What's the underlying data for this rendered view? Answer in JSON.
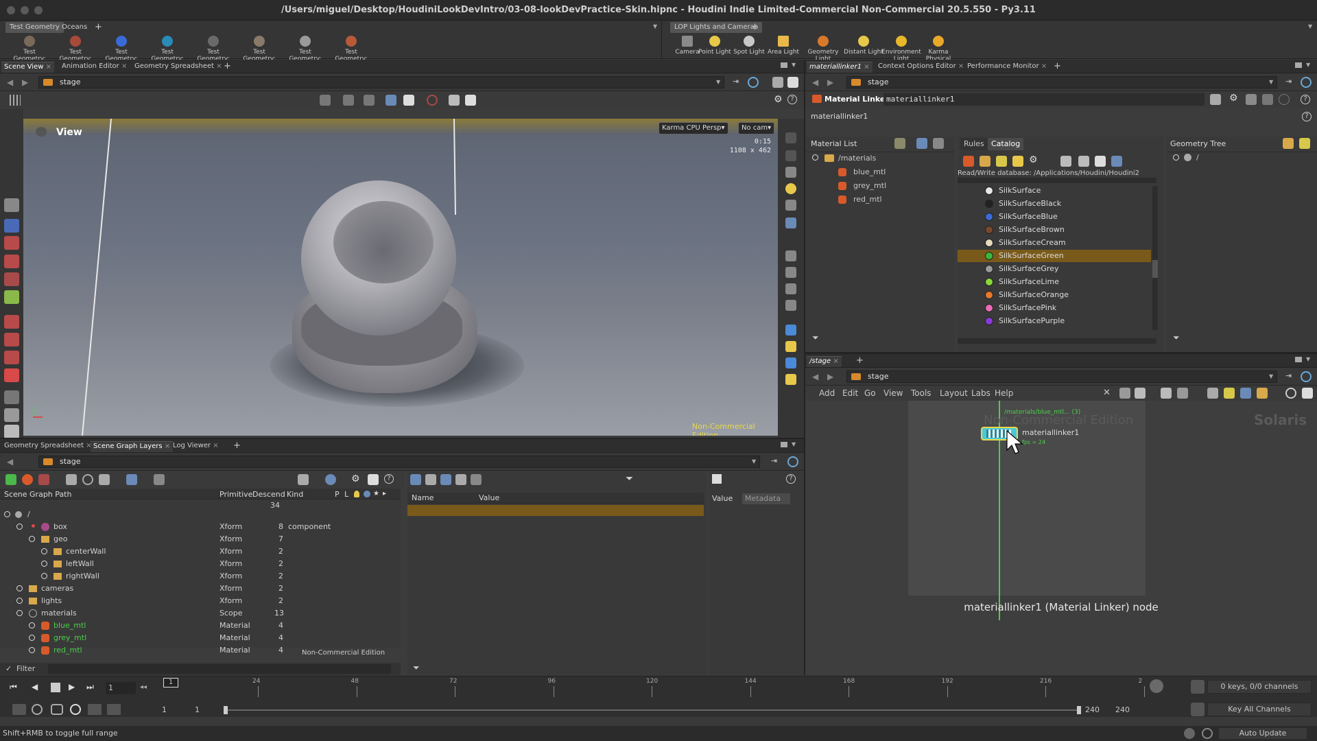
{
  "window": {
    "title": "/Users/miguel/Desktop/HoudiniLookDevIntro/03-08-lookDevPractice-Skin.hipnc - Houdini Indie Limited-Commercial Non-Commercial 20.5.550 - Py3.11"
  },
  "shelf_left": {
    "tabs": [
      "Test Geometry",
      "Oceans"
    ],
    "tools": [
      "Test Geometry: C...",
      "Test Geometry: P...",
      "Test Geometry: R...",
      "Test Geometry: S...",
      "Test Geometry: S...",
      "Test Geometry: T...",
      "Test Geometry: T...",
      "Test Geometry: T..."
    ]
  },
  "shelf_right": {
    "tabs": [
      "LOP Lights and Cameras"
    ],
    "tools": [
      "Camera",
      "Point Light",
      "Spot Light",
      "Area Light",
      "Geometry Light",
      "Distant Light",
      "Environment Light",
      "Karma Physical Sky..."
    ]
  },
  "viewport_panel": {
    "tabs": [
      "Scene View",
      "Animation Editor",
      "Geometry Spreadsheet"
    ],
    "path": "stage",
    "view_label": "View",
    "renderer": "Karma CPU",
    "persp": "Persp",
    "camera": "No cam",
    "time_readout": "0:15",
    "resolution_readout": "1108 x 462",
    "watermark": "Non-Commercial Edition"
  },
  "scene_graph_panel": {
    "tabs": [
      "Geometry Spreadsheet",
      "Scene Graph Layers",
      "Log Viewer"
    ],
    "path": "stage",
    "columns": [
      "Scene Graph Path",
      "Primitive",
      "Descend",
      "Kind",
      "P",
      "L"
    ],
    "root_count": "34",
    "rows": [
      {
        "name": "/",
        "prim": "",
        "desc": "34",
        "kind": ""
      },
      {
        "name": "box",
        "prim": "Xform",
        "desc": "8",
        "kind": "component"
      },
      {
        "name": "geo",
        "prim": "Xform",
        "desc": "7",
        "kind": ""
      },
      {
        "name": "centerWall",
        "prim": "Xform",
        "desc": "2",
        "kind": ""
      },
      {
        "name": "leftWall",
        "prim": "Xform",
        "desc": "2",
        "kind": ""
      },
      {
        "name": "rightWall",
        "prim": "Xform",
        "desc": "2",
        "kind": ""
      },
      {
        "name": "cameras",
        "prim": "Xform",
        "desc": "2",
        "kind": ""
      },
      {
        "name": "lights",
        "prim": "Xform",
        "desc": "2",
        "kind": ""
      },
      {
        "name": "materials",
        "prim": "Scope",
        "desc": "13",
        "kind": ""
      },
      {
        "name": "blue_mtl",
        "prim": "Material",
        "desc": "4",
        "kind": ""
      },
      {
        "name": "grey_mtl",
        "prim": "Material",
        "desc": "4",
        "kind": ""
      },
      {
        "name": "red_mtl",
        "prim": "Material",
        "desc": "4",
        "kind": ""
      }
    ],
    "filter_label": "Filter",
    "watermark": "Non-Commercial Edition",
    "details_columns": [
      "Name",
      "Value"
    ],
    "value_tabs": [
      "Value",
      "Metadata"
    ]
  },
  "material_panel": {
    "tabs": [
      "materiallinker1",
      "Context Options Editor",
      "Performance Monitor"
    ],
    "path": "stage",
    "node_type": "Material Linker",
    "node_name": "materiallinker1",
    "node_label": "materiallinker1",
    "material_list_title": "Material List",
    "material_root": "/materials",
    "materials": [
      "blue_mtl",
      "grey_mtl",
      "red_mtl"
    ],
    "catalog_tabs": [
      "Rules",
      "Catalog"
    ],
    "database_path": "Read/Write database: /Applications/Houdini/Houdini2",
    "catalog_items": [
      {
        "name": "SilkSurface",
        "color": "#e8e8e8"
      },
      {
        "name": "SilkSurfaceBlack",
        "color": "#222222"
      },
      {
        "name": "SilkSurfaceBlue",
        "color": "#3a6ad8"
      },
      {
        "name": "SilkSurfaceBrown",
        "color": "#7a4a2a"
      },
      {
        "name": "SilkSurfaceCream",
        "color": "#e8dcc0"
      },
      {
        "name": "SilkSurfaceGreen",
        "color": "#3ab83a"
      },
      {
        "name": "SilkSurfaceGrey",
        "color": "#9a9a9a"
      },
      {
        "name": "SilkSurfaceLime",
        "color": "#8ad83a"
      },
      {
        "name": "SilkSurfaceOrange",
        "color": "#e8782a"
      },
      {
        "name": "SilkSurfacePink",
        "color": "#e86ab8"
      },
      {
        "name": "SilkSurfacePurple",
        "color": "#8a3ad8"
      }
    ],
    "selected_catalog_item": "SilkSurfaceGreen",
    "geometry_tree_title": "Geometry Tree",
    "geometry_root": "/"
  },
  "network_panel": {
    "tabs": [
      "/stage"
    ],
    "path": "stage",
    "menu": [
      "Add",
      "Edit",
      "Go",
      "View",
      "Tools",
      "Layout",
      "Labs",
      "Help"
    ],
    "edge_label": "/materials/blue_mtl... (3)",
    "watermark": "Non-Commercial Edition",
    "context_label": "Solaris",
    "node_name": "materiallinker1",
    "node_sub": "fps = 24",
    "caption": "materiallinker1 (Material Linker) node"
  },
  "timeline": {
    "frame": "1",
    "ticks": [
      "24",
      "48",
      "72",
      "96",
      "120",
      "144",
      "168",
      "192",
      "216",
      "2"
    ],
    "start": "1",
    "range_start": "1",
    "range_end": "240",
    "end": "240",
    "keys_info": "0 keys, 0/0 channels",
    "key_all": "Key All Channels",
    "auto_update": "Auto Update",
    "current_frame_marker": "1"
  },
  "status": {
    "hint": "Shift+RMB to toggle full range"
  },
  "colors": {
    "accent": "#d88a2a",
    "selection": "#7a5a1a",
    "node_cyan": "#4ac8d8",
    "node_yellow": "#e8d84a",
    "green_text": "#4ad04a"
  }
}
